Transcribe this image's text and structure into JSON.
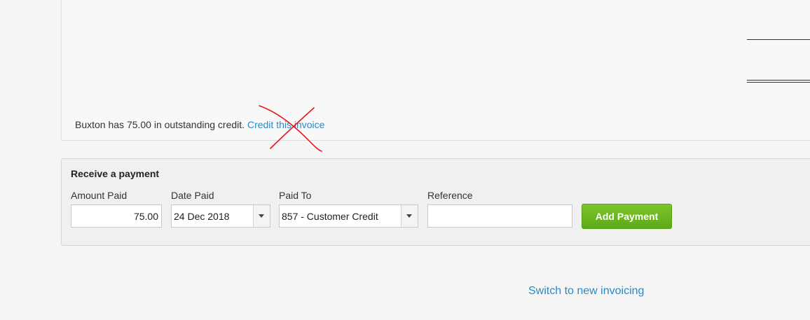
{
  "invoice": {
    "credit_message": "Buxton has 75.00 in outstanding credit.",
    "credit_link": "Credit this invoice"
  },
  "payment": {
    "title": "Receive a payment",
    "amount_label": "Amount Paid",
    "amount_value": "75.00",
    "date_label": "Date Paid",
    "date_value": "24 Dec 2018",
    "paid_to_label": "Paid To",
    "paid_to_value": "857 - Customer Credit",
    "reference_label": "Reference",
    "reference_value": "",
    "add_button": "Add Payment"
  },
  "footer": {
    "switch_link": "Switch to new invoicing"
  },
  "colors": {
    "link": "#2a8ac8",
    "button_green": "#6bb622",
    "annotation_red": "#e8131c"
  }
}
